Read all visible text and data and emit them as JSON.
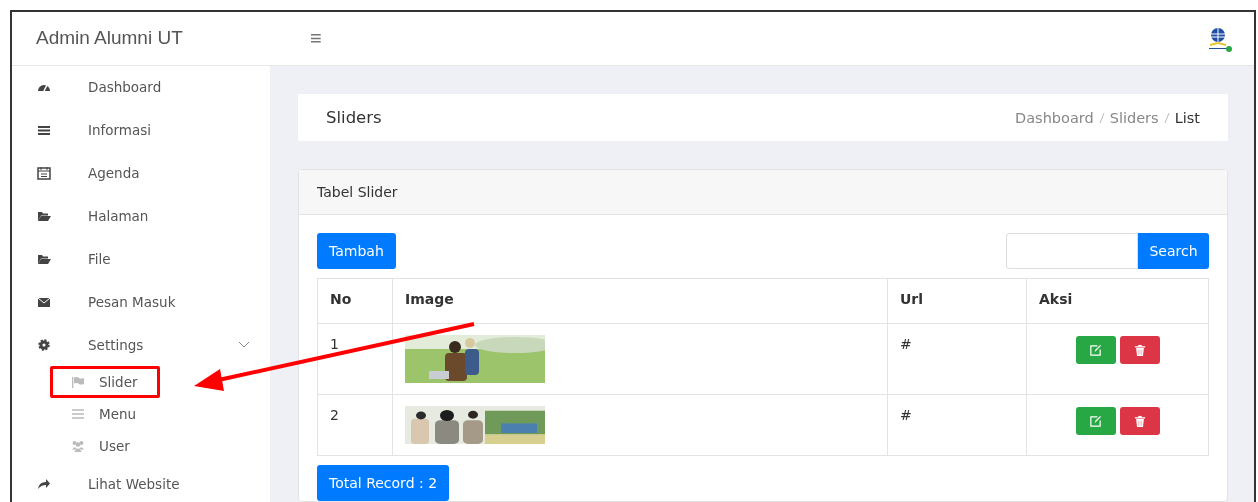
{
  "brand": "Admin Alumni UT",
  "menu_toggle": "≡",
  "sidebar": {
    "items": [
      {
        "label": "Dashboard"
      },
      {
        "label": "Informasi"
      },
      {
        "label": "Agenda"
      },
      {
        "label": "Halaman"
      },
      {
        "label": "File"
      },
      {
        "label": "Pesan Masuk"
      },
      {
        "label": "Settings",
        "expanded": true,
        "children": [
          {
            "label": "Slider",
            "highlighted": true
          },
          {
            "label": "Menu",
            "highlighted": false
          },
          {
            "label": "User",
            "highlighted": false
          }
        ]
      },
      {
        "label": "Lihat Website"
      }
    ]
  },
  "page_title": "Sliders",
  "breadcrumb": [
    {
      "label": "Dashboard",
      "selected": false
    },
    {
      "label": "Sliders",
      "selected": false
    },
    {
      "label": "List",
      "selected": true
    }
  ],
  "card_title": "Tabel Slider",
  "add_button": "Tambah",
  "search_button": "Search",
  "table": {
    "columns": [
      "No",
      "Image",
      "Url",
      "Aksi"
    ],
    "rows": [
      {
        "no": "1",
        "url": "#"
      },
      {
        "no": "2",
        "url": "#"
      }
    ]
  },
  "total_record": "Total Record : 2"
}
